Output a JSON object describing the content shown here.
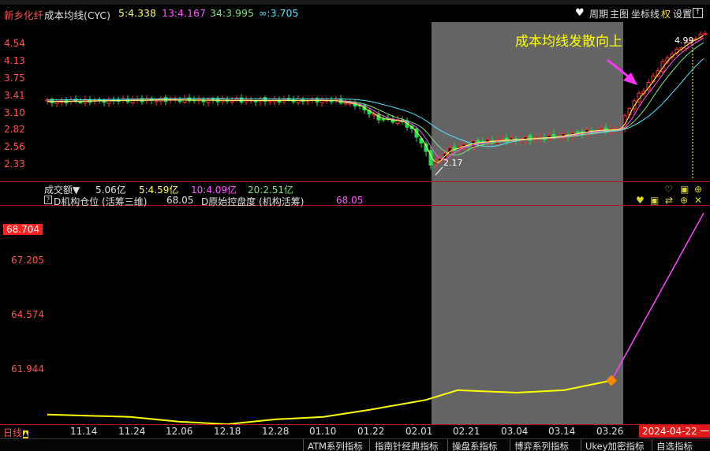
{
  "top_tabs": [],
  "header": {
    "stock_name": "新乡化纤",
    "indicator_name": "成本均线(CYC)",
    "ma5": "5:4.338",
    "ma13": "13:4.167",
    "ma34": "34:3.995",
    "ma_inf": "∞:3.705",
    "menu_period": "周期",
    "menu_main": "主图",
    "menu_axis": "坐标线",
    "menu_right": "权",
    "menu_settings": "设置"
  },
  "annotation": {
    "text": "成本均线发散向上",
    "high_label": "4.99",
    "low_label": "2.17"
  },
  "price_axis": [
    "4.54",
    "4.13",
    "3.75",
    "3.41",
    "3.10",
    "2.82",
    "2.56",
    "2.33"
  ],
  "volume_bar": {
    "label": "成交额▼",
    "total": "5.06亿",
    "ma5": "5:4.59亿",
    "ma10": "10:4.09亿",
    "ma20": "20:2.51亿"
  },
  "indicator_bar": {
    "line1_label": "D机构仓位 (活筹三维)",
    "line1_value": "68.05",
    "line2_label": "D原始控盘度 (机构活筹)",
    "line2_value": "68.05"
  },
  "indicator_axis": {
    "current": "68.704",
    "ticks": [
      "67.205",
      "64.574",
      "61.944"
    ]
  },
  "dates": [
    "11.14",
    "11.24",
    "12.06",
    "12.18",
    "12.28",
    "01.10",
    "01.22",
    "02.01",
    "02.21",
    "03.04",
    "03.14",
    "03.26"
  ],
  "current_date": "2024-04-22 一",
  "period_label": "日线",
  "bottom_tabs": [
    "ATM系列指标",
    "指南针经典指标",
    "操盘系指标",
    "博弈系列指标",
    "Ukey加密指标",
    "自选指标"
  ],
  "colors": {
    "up": "#ff3030",
    "down": "#20e050",
    "ma5": "#ffff55",
    "ma13": "#ff55ff",
    "ma34": "#7fe07f",
    "ma_inf": "#55e5ff",
    "indicator_line": "#ff44ff",
    "indicator_base": "#ffff00",
    "shade": "#646464"
  },
  "chart_data": {
    "type": "line",
    "title": "",
    "xlabel": "",
    "ylabel": "",
    "x": [
      "11.14",
      "11.24",
      "12.06",
      "12.18",
      "12.28",
      "01.10",
      "01.22",
      "02.01",
      "02.21",
      "03.04",
      "03.14",
      "03.26",
      "04.22"
    ],
    "series": [
      {
        "name": "D机构仓位",
        "values": [
          60.4,
          60.3,
          60.1,
          60.0,
          60.2,
          60.3,
          60.6,
          61.0,
          61.4,
          61.3,
          61.4,
          61.8,
          68.7
        ]
      }
    ],
    "ylim": [
      60.0,
      69.0
    ]
  }
}
